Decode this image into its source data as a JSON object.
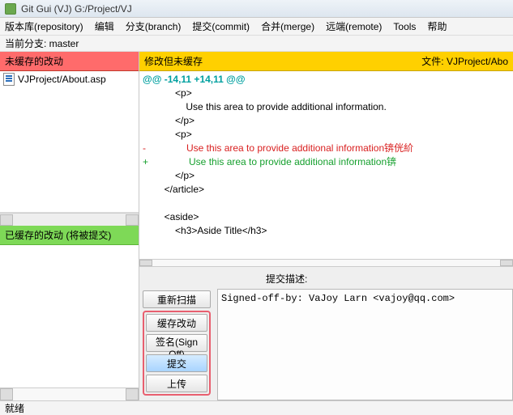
{
  "window": {
    "title": "Git Gui (VJ) G:/Project/VJ"
  },
  "menu": {
    "repository": "版本库(repository)",
    "edit": "编辑",
    "branch": "分支(branch)",
    "commit": "提交(commit)",
    "merge": "合并(merge)",
    "remote": "远端(remote)",
    "tools": "Tools",
    "help": "帮助"
  },
  "branch": {
    "label": "当前分支: master"
  },
  "unstaged": {
    "header": "未缓存的改动",
    "files": [
      {
        "name": "VJProject/About.asp"
      }
    ]
  },
  "staged": {
    "header": "已缓存的改动 (将被提交)"
  },
  "diff": {
    "header_left": "修改但未缓存",
    "header_right_label": "文件:",
    "header_right_file": "VJProject/Abo",
    "hunk": "@@ -14,11 +14,11 @@",
    "lines": [
      {
        "t": "ctx",
        "v": "            <p>"
      },
      {
        "t": "ctx",
        "v": "                Use this area to provide additional information."
      },
      {
        "t": "ctx",
        "v": "            </p>"
      },
      {
        "t": "ctx",
        "v": "            <p>"
      },
      {
        "t": "del",
        "v": "-               Use this area to provide additional information锛侊紒"
      },
      {
        "t": "add",
        "v": "+               Use this area to provide additional information锛"
      },
      {
        "t": "ctx",
        "v": "            </p>"
      },
      {
        "t": "ctx",
        "v": "        </article>"
      },
      {
        "t": "ctx",
        "v": ""
      },
      {
        "t": "ctx",
        "v": "        <aside>"
      },
      {
        "t": "ctx",
        "v": "            <h3>Aside Title</h3>"
      }
    ]
  },
  "buttons": {
    "rescan": "重新扫描",
    "stage": "缓存改动",
    "signoff": "签名(Sign Off)",
    "commit": "提交",
    "push": "上传"
  },
  "commit": {
    "label": "提交描述:",
    "message": "Signed-off-by: VaJoy Larn <vajoy@qq.com>"
  },
  "status": {
    "text": "就绪"
  }
}
